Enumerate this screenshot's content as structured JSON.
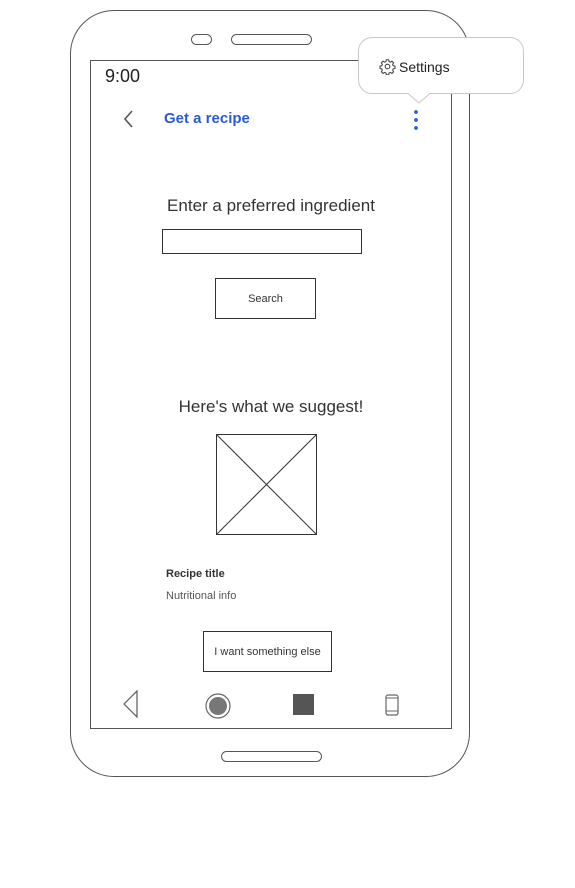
{
  "status_bar": {
    "time": "9:00"
  },
  "header": {
    "title": "Get a recipe",
    "back_icon": "chevron-left-icon",
    "menu_icon": "more-vertical-icon"
  },
  "menu_popup": {
    "items": [
      {
        "label": "Settings",
        "icon": "gear-icon"
      }
    ]
  },
  "search_section": {
    "prompt": "Enter a preferred ingredient",
    "input_value": "",
    "button_label": "Search"
  },
  "suggestion_section": {
    "heading": "Here's what we suggest!",
    "image_icon": "image-placeholder-icon",
    "recipe_title": "Recipe title",
    "nutritional_info": "Nutritional info",
    "alt_button_label": "I want something else"
  },
  "nav_bar": {
    "icons": [
      "back-triangle-icon",
      "home-circle-icon",
      "recents-square-icon",
      "rotate-phone-icon"
    ]
  },
  "colors": {
    "accent": "#2a5bd7",
    "outline": "#333333"
  }
}
